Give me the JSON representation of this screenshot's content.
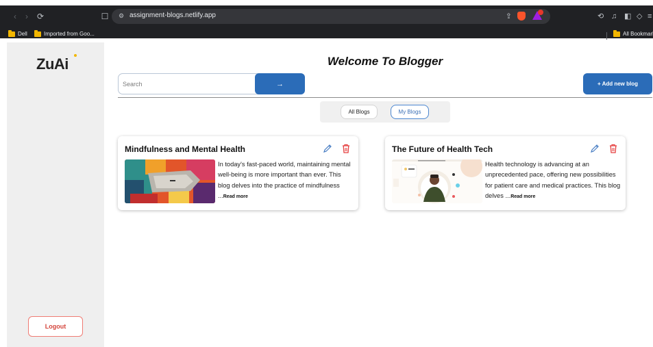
{
  "browser": {
    "url": "assignment-blogs.netlify.app",
    "bookmarks": [
      "Dell",
      "Imported from Goo...",
      "All Bookmarks"
    ],
    "colors": {
      "chrome": "#202124",
      "urlbar": "#35363a"
    }
  },
  "sidebar": {
    "logo": "ZuAi",
    "logout_label": "Logout"
  },
  "main": {
    "title": "Welcome To Blogger",
    "search": {
      "placeholder": "Search",
      "button_label": "→"
    },
    "add_button_label": "+ Add new blog",
    "tabs": [
      {
        "label": "All Blogs",
        "selected": false
      },
      {
        "label": "My Blogs",
        "selected": true
      }
    ],
    "blogs": [
      {
        "title": "Mindfulness and Mental Health",
        "excerpt": "In today's fast-paced world, maintaining mental well-being is more important than ever. This blog delves into the practice of mindfulness ...",
        "read_more": "Read more",
        "image": "abstract-painting"
      },
      {
        "title": "The Future of Health Tech",
        "excerpt": "Health technology is advancing at an unprecedented pace, offering new possibilities for patient care and medical practices. This blog delves ...",
        "read_more": "Read more",
        "image": "person-web-illustration"
      }
    ],
    "colors": {
      "primary": "#2b6cb8",
      "danger": "#e53e3e",
      "logout": "#d4443b"
    }
  }
}
